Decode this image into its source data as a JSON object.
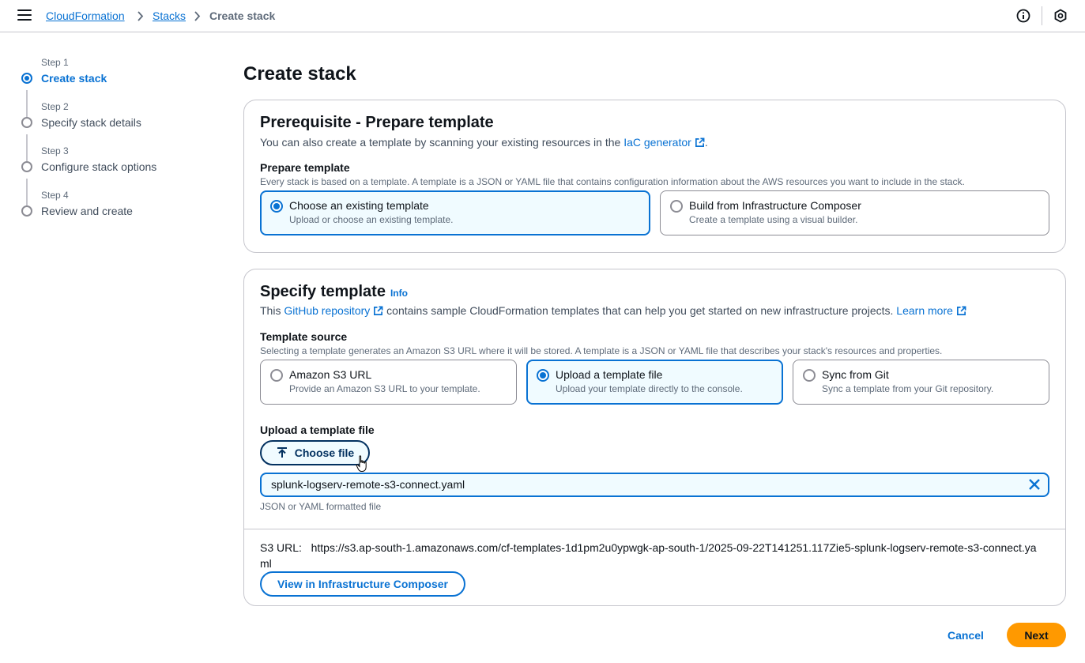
{
  "breadcrumbs": {
    "items": [
      "CloudFormation",
      "Stacks"
    ],
    "current": "Create stack"
  },
  "steps": [
    {
      "number": "Step 1",
      "title": "Create stack",
      "active": true
    },
    {
      "number": "Step 2",
      "title": "Specify stack details",
      "active": false
    },
    {
      "number": "Step 3",
      "title": "Configure stack options",
      "active": false
    },
    {
      "number": "Step 4",
      "title": "Review and create",
      "active": false
    }
  ],
  "page_title": "Create stack",
  "prerequisite": {
    "heading": "Prerequisite - Prepare template",
    "desc_prefix": "You can also create a template by scanning your existing resources in the",
    "desc_link": "IaC generator",
    "desc_suffix": ".",
    "label": "Prepare template",
    "sublabel": "Every stack is based on a template. A template is a JSON or YAML file that contains configuration information about the AWS resources you want to include in the stack.",
    "options": [
      {
        "title": "Choose an existing template",
        "desc": "Upload or choose an existing template.",
        "selected": true
      },
      {
        "title": "Build from Infrastructure Composer",
        "desc": "Create a template using a visual builder.",
        "selected": false
      }
    ]
  },
  "specify": {
    "heading": "Specify template",
    "info": "Info",
    "desc_prefix": "This",
    "desc_link": "GitHub repository",
    "desc_middle": "contains sample CloudFormation templates that can help you get started on new infrastructure projects.",
    "learn_more": "Learn more",
    "source_label": "Template source",
    "source_sublabel": "Selecting a template generates an Amazon S3 URL where it will be stored. A template is a JSON or YAML file that describes your stack's resources and properties.",
    "sources": [
      {
        "title": "Amazon S3 URL",
        "desc": "Provide an Amazon S3 URL to your template.",
        "selected": false
      },
      {
        "title": "Upload a template file",
        "desc": "Upload your template directly to the console.",
        "selected": true
      },
      {
        "title": "Sync from Git",
        "desc": "Sync a template from your Git repository.",
        "selected": false
      }
    ],
    "upload_label": "Upload a template file",
    "choose_file": "Choose file",
    "file_name": "splunk-logserv-remote-s3-connect.yaml",
    "file_hint": "JSON or YAML formatted file",
    "s3_url_label": "S3 URL:",
    "s3_url_value": "https://s3.ap-south-1.amazonaws.com/cf-templates-1d1pm2u0ypwgk-ap-south-1/2025-09-22T141251.117Zie5-splunk-logserv-remote-s3-connect.yaml",
    "view_composer": "View in Infrastructure Composer"
  },
  "actions": {
    "cancel": "Cancel",
    "next": "Next"
  },
  "colors": {
    "link": "#0972d3",
    "primary_button": "#ff9900",
    "selected_bg": "#f0fbff",
    "border": "#c6c6cd"
  },
  "icons": [
    "menu-icon",
    "chevron-right-icon",
    "info-icon",
    "settings-hexagon-icon",
    "external-link-icon",
    "upload-icon",
    "close-icon",
    "pointer-cursor-icon"
  ]
}
